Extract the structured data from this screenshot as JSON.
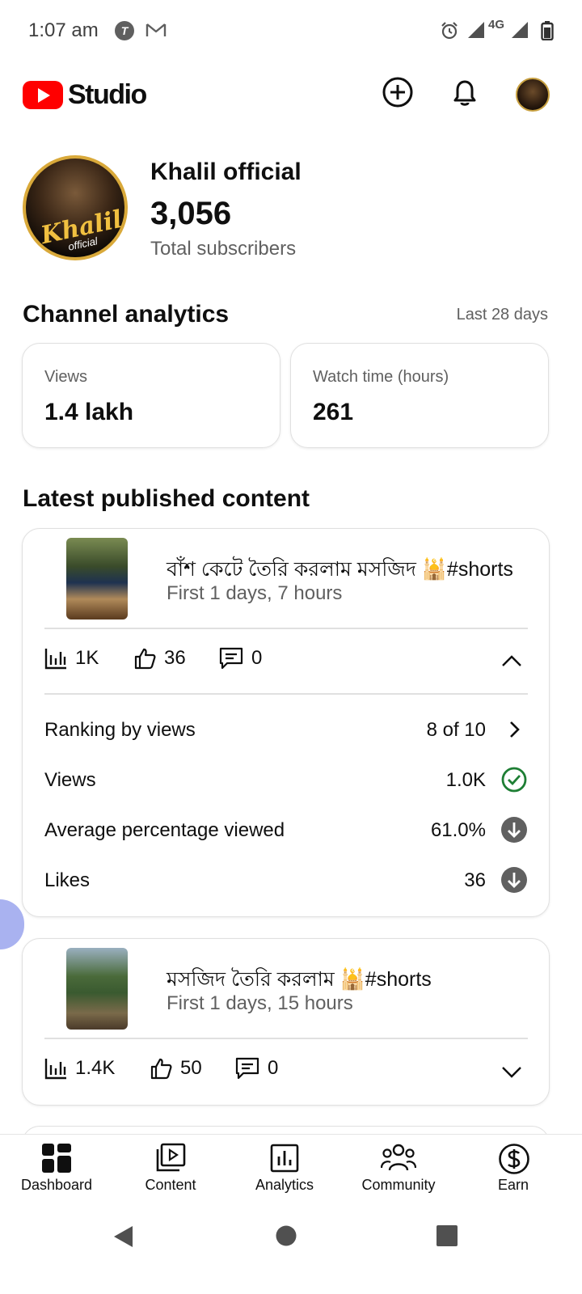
{
  "status_bar": {
    "time": "1:07 am",
    "network": "4G",
    "t_badge": "T"
  },
  "app_bar": {
    "logo_text": "Studio"
  },
  "channel": {
    "name": "Khalil official",
    "subscribers": "3,056",
    "subscribers_label": "Total subscribers",
    "avatar_text": "Khalil",
    "avatar_subtext": "official"
  },
  "analytics": {
    "title": "Channel analytics",
    "range": "Last 28 days",
    "metrics": [
      {
        "label": "Views",
        "value": "1.4 lakh"
      },
      {
        "label": "Watch time (hours)",
        "value": "261"
      }
    ]
  },
  "latest": {
    "title": "Latest published content",
    "videos": [
      {
        "title": "বাঁশ কেটে তৈরি করলাম মসজিদ 🕌#shorts",
        "age": "First 1 days, 7 hours",
        "views": "1K",
        "likes": "36",
        "comments": "0",
        "details": [
          {
            "label": "Ranking by views",
            "value": "8 of 10",
            "icon": "chevron-right-icon"
          },
          {
            "label": "Views",
            "value": "1.0K",
            "icon": "check-circle-icon"
          },
          {
            "label": "Average percentage viewed",
            "value": "61.0%",
            "icon": "arrow-down-circle-icon"
          },
          {
            "label": "Likes",
            "value": "36",
            "icon": "arrow-down-circle-icon"
          }
        ]
      },
      {
        "title": "মসজিদ তৈরি করলাম 🕌#shorts",
        "age": "First 1 days, 15 hours",
        "views": "1.4K",
        "likes": "50",
        "comments": "0"
      }
    ]
  },
  "bottom_nav": {
    "items": [
      {
        "label": "Dashboard",
        "icon": "dashboard-icon"
      },
      {
        "label": "Content",
        "icon": "content-icon"
      },
      {
        "label": "Analytics",
        "icon": "analytics-icon"
      },
      {
        "label": "Community",
        "icon": "community-icon"
      },
      {
        "label": "Earn",
        "icon": "earn-icon"
      }
    ]
  },
  "colors": {
    "brand_red": "#ff0000",
    "success_green": "#1e7e34",
    "text_secondary": "#606060"
  }
}
